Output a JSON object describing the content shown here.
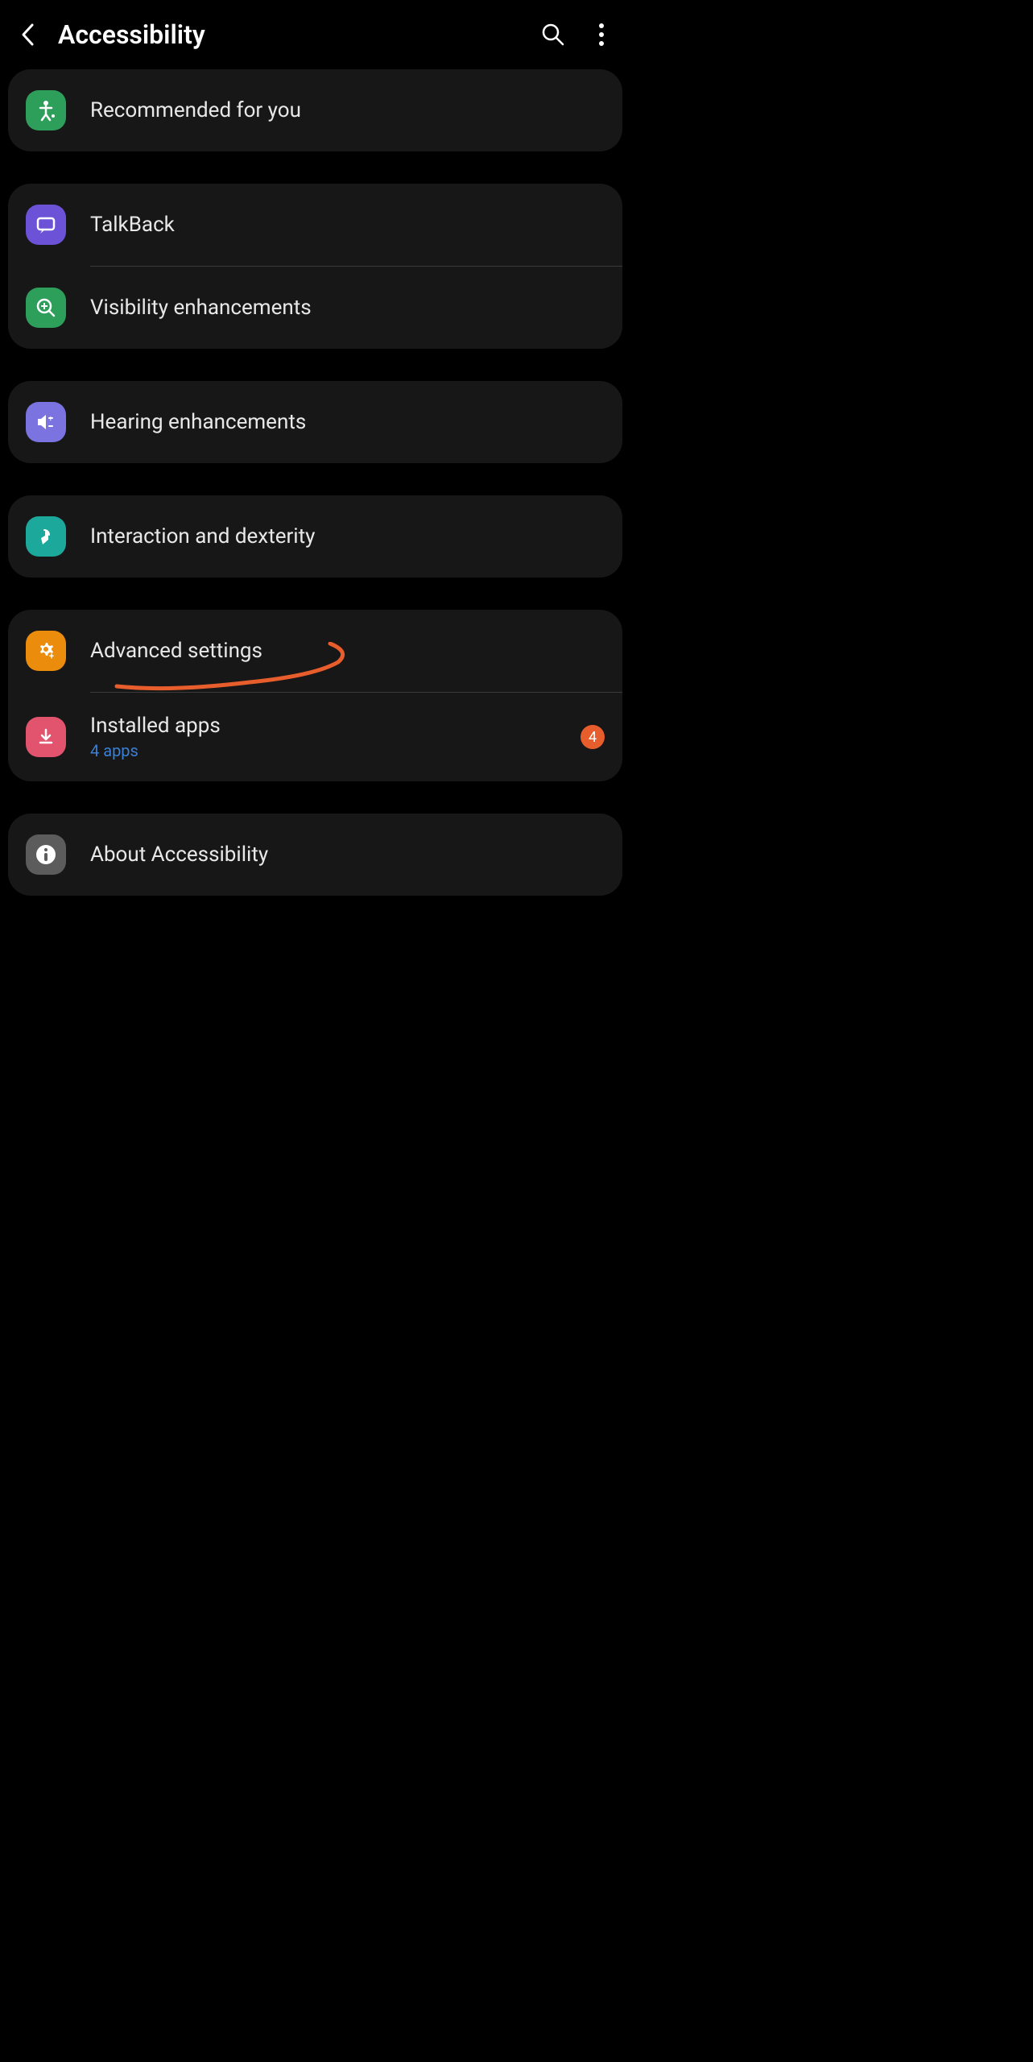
{
  "header": {
    "title": "Accessibility"
  },
  "sections": {
    "recommended": {
      "label": "Recommended for you"
    },
    "talkback": {
      "label": "TalkBack"
    },
    "visibility": {
      "label": "Visibility enhancements"
    },
    "hearing": {
      "label": "Hearing enhancements"
    },
    "interaction": {
      "label": "Interaction and dexterity"
    },
    "advanced": {
      "label": "Advanced settings"
    },
    "installed": {
      "label": "Installed apps",
      "sub": "4 apps",
      "badge": "4"
    },
    "about": {
      "label": "About Accessibility"
    }
  }
}
